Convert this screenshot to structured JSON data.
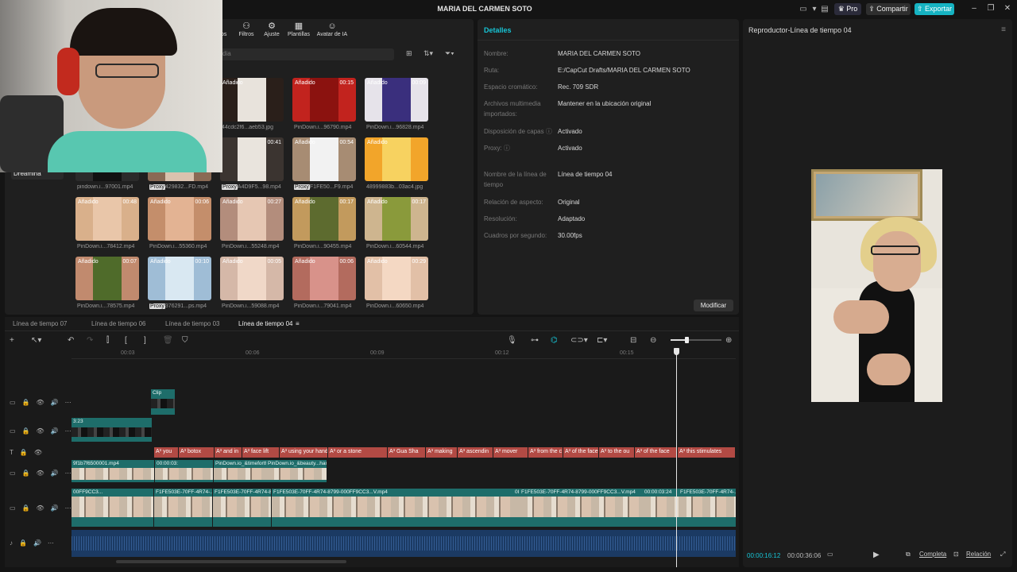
{
  "window": {
    "title": "MARIA DEL CARMEN SOTO",
    "pro_label": "Pro",
    "share_label": "Compartir",
    "export_label": "Exportar"
  },
  "media": {
    "toptabs": [
      {
        "label": "dios",
        "icon": "audio-icon"
      },
      {
        "label": "Filtros",
        "icon": "filters-icon"
      },
      {
        "label": "Ajuste",
        "icon": "adjust-icon"
      },
      {
        "label": "Plantillas",
        "icon": "templates-icon"
      },
      {
        "label": "Avatar de IA",
        "icon": "ai-avatar-icon"
      }
    ],
    "search_placeholder": "dia",
    "sidebar_selected": "Dreamina",
    "added_label": "Añadido",
    "proxy_label": "Proxy",
    "items": [
      {
        "duration": "",
        "caption": "44cdc2f6...aeb53.jpg",
        "added": true,
        "proxy": false
      },
      {
        "duration": "00:15",
        "caption": "PinDown.i...96790.mp4",
        "added": true,
        "proxy": false
      },
      {
        "duration": "00:09",
        "caption": "PinDown.i...96828.mp4",
        "added": true,
        "proxy": false
      },
      {
        "duration": "",
        "caption": "pindown.i...97001.mp4",
        "added": false,
        "proxy": false
      },
      {
        "duration": "",
        "caption": "429832...FD.mp4",
        "added": false,
        "proxy": true
      },
      {
        "duration": "00:41",
        "caption": "A4D9F5...98.mp4",
        "added": false,
        "proxy": true
      },
      {
        "duration": "00:54",
        "caption": "F1FE50...F9.mp4",
        "added": true,
        "proxy": true
      },
      {
        "duration": "",
        "caption": "48999883b...03ac4.jpg",
        "added": true,
        "proxy": false
      },
      {
        "duration": "00:48",
        "caption": "PinDown.i...78412.mp4",
        "added": true,
        "proxy": false
      },
      {
        "duration": "00:06",
        "caption": "PinDown.i...55360.mp4",
        "added": true,
        "proxy": false
      },
      {
        "duration": "00:27",
        "caption": "PinDown.i...55248.mp4",
        "added": true,
        "proxy": false
      },
      {
        "duration": "00:17",
        "caption": "PinDown.i...90455.mp4",
        "added": true,
        "proxy": false
      },
      {
        "duration": "00:17",
        "caption": "PinDown.i...60544.mp4",
        "added": true,
        "proxy": false
      },
      {
        "duration": "00:07",
        "caption": "PinDown.i...78575.mp4",
        "added": true,
        "proxy": false
      },
      {
        "duration": "00:10",
        "caption": "376291...ps.mp4",
        "added": true,
        "proxy": true
      },
      {
        "duration": "00:05",
        "caption": "PinDown.i...59088.mp4",
        "added": true,
        "proxy": false
      },
      {
        "duration": "00:06",
        "caption": "PinDown.i...79041.mp4",
        "added": true,
        "proxy": false
      },
      {
        "duration": "00:29",
        "caption": "PinDown.i...60650.mp4",
        "added": true,
        "proxy": false
      }
    ]
  },
  "details": {
    "header": "Detalles",
    "rows": [
      {
        "k": "Nombre:",
        "v": "MARIA DEL CARMEN SOTO"
      },
      {
        "k": "Ruta:",
        "v": "E:/CapCut Drafts/MARIA DEL CARMEN SOTO"
      },
      {
        "k": "Espacio cromático:",
        "v": "Rec. 709 SDR"
      },
      {
        "k": "Archivos multimedia importados:",
        "v": "Mantener en la ubicación original"
      },
      {
        "k": "Disposición de capas ⓘ",
        "v": "Activado"
      },
      {
        "k": "Proxy: ⓘ",
        "v": "Activado"
      },
      {
        "k": "Nombre de la línea de tiempo",
        "v": "Línea de tiempo 04"
      },
      {
        "k": "Relación de aspecto:",
        "v": "Original"
      },
      {
        "k": "Resolución:",
        "v": "Adaptado"
      },
      {
        "k": "Cuadros por segundo:",
        "v": "30.00fps"
      }
    ],
    "modify_label": "Modificar"
  },
  "player": {
    "header": "Reproductor-Línea de tiempo 04",
    "current_time": "00:00:16:12",
    "total_time": "00:00:36:06",
    "full_label": "Completa",
    "ratio_label": "Relación"
  },
  "timeline": {
    "tabs": [
      "Línea de tiempo 07",
      "Línea de tiempo 06",
      "Línea de tiempo 03",
      "Línea de tiempo 04"
    ],
    "active_tab": 3,
    "ruler": [
      "00:03",
      "00:06",
      "00:09",
      "00:12",
      "00:15"
    ],
    "overlay_clip_label": "Clip",
    "small_clip_time": "3:23",
    "text_clips": [
      "you",
      "botox",
      "and in",
      "face lift",
      "using your hands",
      "or a stone",
      "Gua Sha",
      "making",
      "ascendin",
      "mover",
      "from the c",
      "of the face",
      "to the ou",
      "of the face",
      "this stimulates"
    ],
    "video2_labels": [
      "9f1b7f6500001.mp4",
      "00:00:03:",
      "PinDown.io_&timeforthe",
      "PinDown.io_&beauty...hanceacademy"
    ],
    "main_labels": [
      "00FF9CC3...",
      "F1FE503E-70FF-4R74-...",
      "F1FE503E-70FF-4R74-8...",
      "F1FE503E-70FF-4R74-8799-000FF9CC3...V.mp4",
      "0I",
      "F1FE503E-70FF-4R74-8799-000FF9CC3...V.mp4",
      "00:00:03:24",
      "F1FE503E-70FF-4R74-..."
    ]
  }
}
